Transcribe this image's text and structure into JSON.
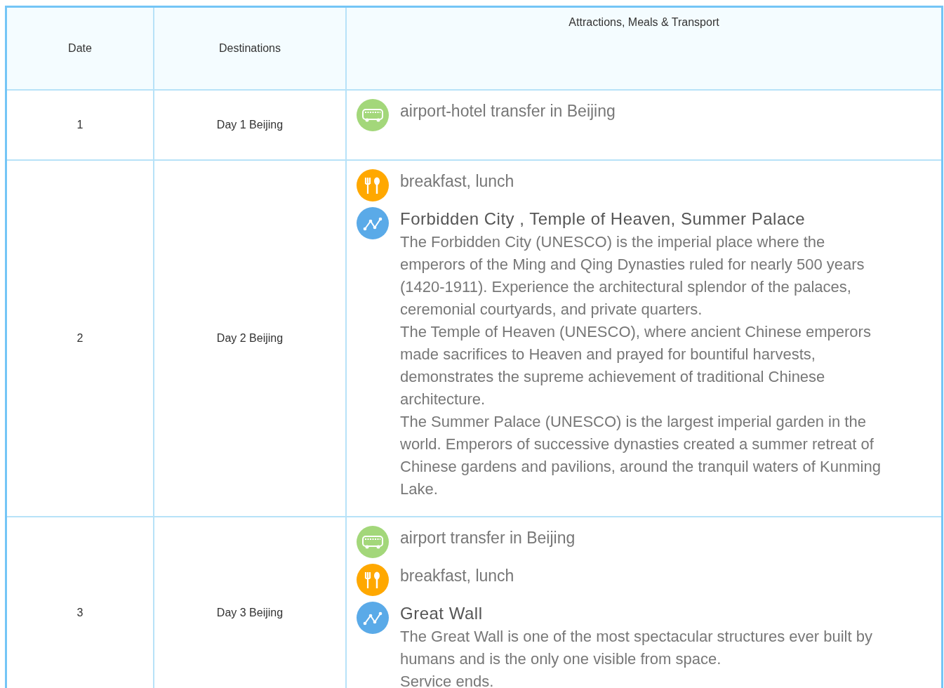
{
  "table": {
    "columns": [
      "Date",
      "Destinations",
      "Attractions, Meals & Transport"
    ],
    "rows": [
      {
        "date": "1",
        "destination": "Day 1 Beijing",
        "items": [
          {
            "kind": "transport",
            "text": "airport-hotel transfer in Beijing"
          }
        ]
      },
      {
        "date": "2",
        "destination": "Day 2 Beijing",
        "items": [
          {
            "kind": "meal",
            "text": "breakfast, lunch"
          },
          {
            "kind": "sight",
            "text": "Forbidden City , Temple of Heaven, Summer Palace",
            "paragraphs": [
              "The Forbidden City (UNESCO) is the imperial place where the emperors of the Ming and Qing Dynasties ruled for nearly 500 years (1420-1911). Experience the architectural splendor of the palaces, ceremonial courtyards, and private quarters.",
              "The Temple of Heaven (UNESCO), where ancient Chinese emperors made sacrifices to Heaven and prayed for bountiful harvests, demonstrates the supreme achievement of traditional Chinese architecture.",
              "The Summer Palace (UNESCO) is the largest imperial garden in the world. Emperors of successive dynasties created a summer retreat of Chinese gardens and pavilions, around the tranquil waters of Kunming Lake."
            ]
          }
        ]
      },
      {
        "date": "3",
        "destination": "Day 3 Beijing",
        "items": [
          {
            "kind": "transport",
            "text": "airport transfer in Beijing"
          },
          {
            "kind": "meal",
            "text": "breakfast, lunch"
          },
          {
            "kind": "sight",
            "text": "Great Wall",
            "paragraphs": [
              "The Great Wall is one of the most spectacular structures ever built by humans and is the only one visible from space.",
              "Service ends."
            ]
          }
        ]
      }
    ]
  }
}
